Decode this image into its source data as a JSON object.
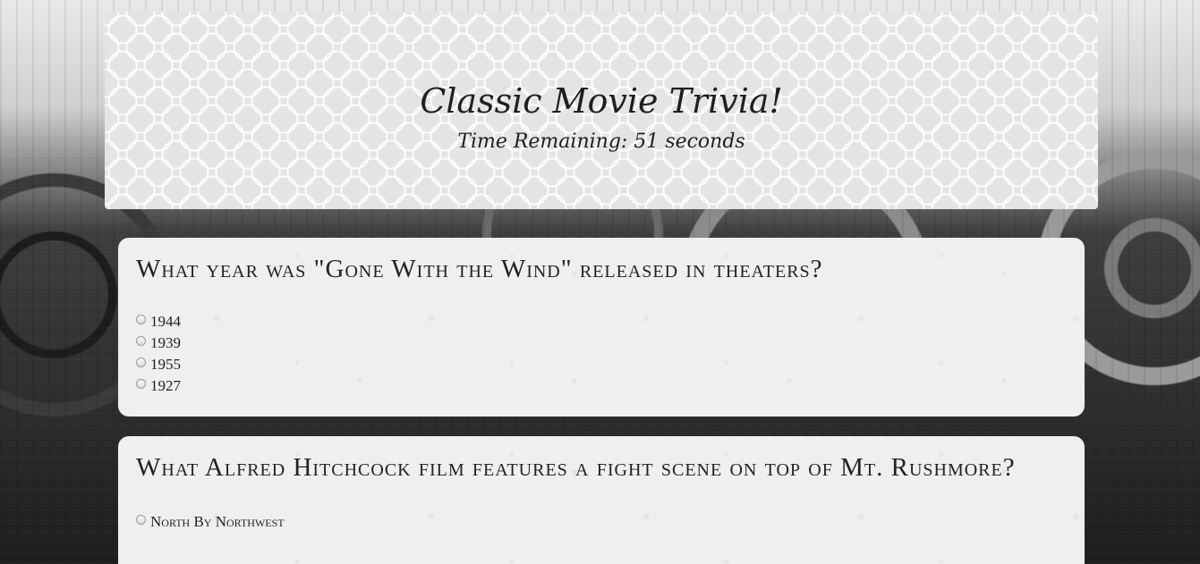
{
  "header": {
    "title": "Classic Movie Trivia!",
    "timer_text": "Time Remaining: 51 seconds"
  },
  "questions": [
    {
      "text": "What year was \"Gone With the Wind\" released in theaters?",
      "options": [
        "1944",
        "1939",
        "1955",
        "1927"
      ]
    },
    {
      "text": "What Alfred Hitchcock film features a fight scene on top of Mt. Rushmore?",
      "options": [
        "North By Northwest"
      ]
    }
  ]
}
